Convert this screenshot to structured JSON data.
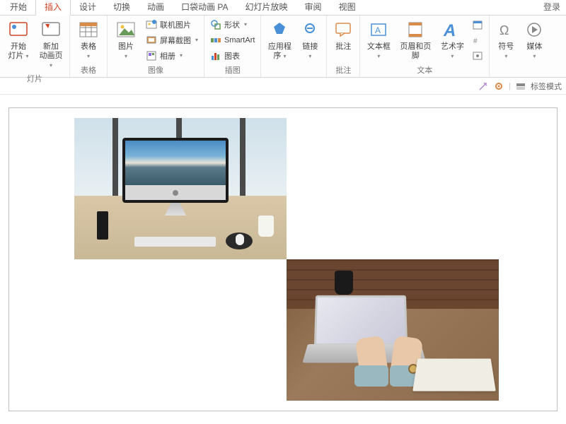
{
  "tabs": {
    "items": [
      "开始",
      "插入",
      "设计",
      "切换",
      "动画",
      "口袋动画 PA",
      "幻灯片放映",
      "审阅",
      "视图"
    ],
    "active_index": 1,
    "login": "登录"
  },
  "ribbon": {
    "groups": [
      {
        "label": "灯片",
        "big": [
          {
            "label": "开始\n灯片",
            "caret": true
          },
          {
            "label": "新加\n动画页",
            "caret": true
          }
        ]
      },
      {
        "label": "表格",
        "big": [
          {
            "label": "表格",
            "caret": true
          }
        ]
      },
      {
        "label": "图像",
        "big": [
          {
            "label": "图片",
            "caret": true
          }
        ],
        "small": [
          {
            "label": "联机图片"
          },
          {
            "label": "屏幕截图",
            "caret": true
          },
          {
            "label": "相册",
            "caret": true
          }
        ]
      },
      {
        "label": "插图",
        "small": [
          {
            "label": "形状",
            "caret": true
          },
          {
            "label": "SmartArt"
          },
          {
            "label": "图表"
          }
        ]
      },
      {
        "label": "",
        "big": [
          {
            "label": "应用程\n序",
            "caret": true
          },
          {
            "label": "链接",
            "caret": true
          }
        ]
      },
      {
        "label": "批注",
        "big": [
          {
            "label": "批注"
          }
        ]
      },
      {
        "label": "文本",
        "big": [
          {
            "label": "文本框",
            "caret": true
          },
          {
            "label": "页眉和页脚"
          },
          {
            "label": "艺术字",
            "caret": true
          }
        ],
        "small_icons": 3
      },
      {
        "label": "",
        "big": [
          {
            "label": "符号",
            "caret": true
          },
          {
            "label": "媒体",
            "caret": true
          }
        ]
      }
    ]
  },
  "subbar": {
    "tag_mode": "标签模式"
  }
}
